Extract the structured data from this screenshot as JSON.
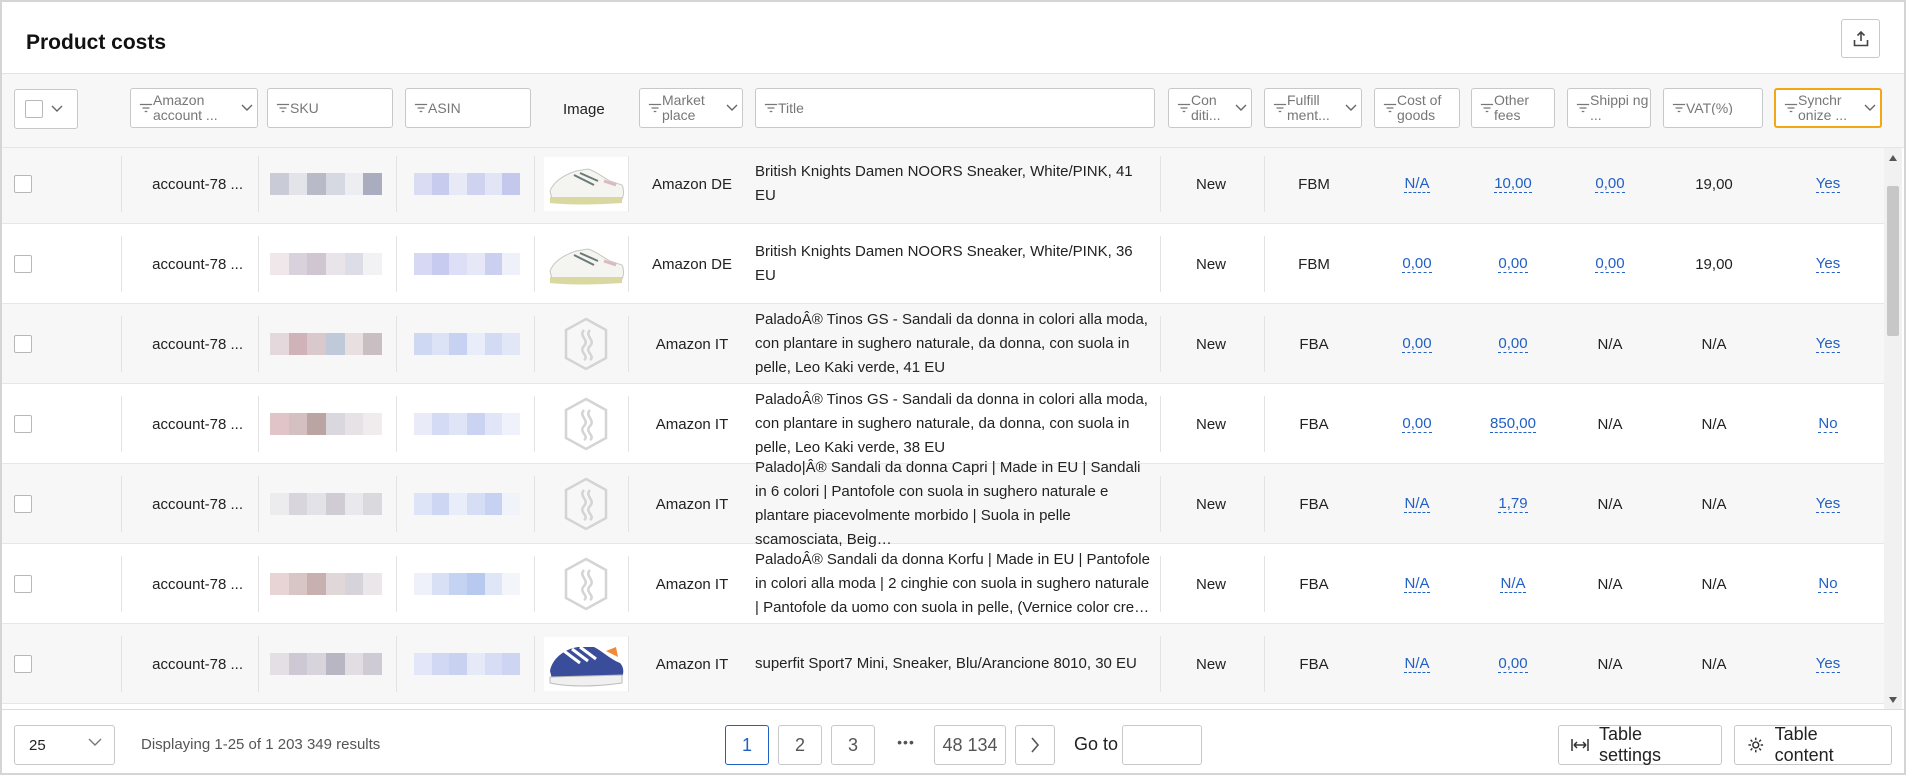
{
  "page": {
    "title": "Product costs"
  },
  "colors": {
    "accent": "#2160c4",
    "highlight": "#f3a712"
  },
  "filters": {
    "amazon_account": "Amazon account ...",
    "sku": "SKU",
    "asin": "ASIN",
    "image": "Image",
    "marketplace": "Market place",
    "title": "Title",
    "condition": "Con diti...",
    "fulfillment": "Fulfill ment...",
    "cost_of_goods": "Cost of goods",
    "other_fees": "Other fees",
    "shipping": "Shippi ng ...",
    "vat": "VAT(%)",
    "synchronize": "Synchr onize ..."
  },
  "rows": [
    {
      "account": "account-78 ...",
      "marketplace": "Amazon DE",
      "title": "British Knights Damen NOORS Sneaker, White/PINK, 41 EU",
      "condition": "New",
      "fulfillment": "FBM",
      "cost": "N/A",
      "other": "10,00",
      "shipping": "0,00",
      "vat": "19,00",
      "sync": "Yes",
      "image": "sneaker-white",
      "shipping_link": true,
      "vat_link": false
    },
    {
      "account": "account-78 ...",
      "marketplace": "Amazon DE",
      "title": "British Knights Damen NOORS Sneaker, White/PINK, 36 EU",
      "condition": "New",
      "fulfillment": "FBM",
      "cost": "0,00",
      "other": "0,00",
      "shipping": "0,00",
      "vat": "19,00",
      "sync": "Yes",
      "image": "sneaker-white",
      "shipping_link": true,
      "vat_link": false
    },
    {
      "account": "account-78 ...",
      "marketplace": "Amazon IT",
      "title": "PaladoÂ® Tinos GS - Sandali da donna in colori alla moda, con plantare in sughero naturale, da donna, con suola in pelle, Leo Kaki verde, 41 EU",
      "condition": "New",
      "fulfillment": "FBA",
      "cost": "0,00",
      "other": "0,00",
      "shipping": "N/A",
      "vat": "N/A",
      "sync": "Yes",
      "image": "placeholder",
      "shipping_link": false,
      "vat_link": false
    },
    {
      "account": "account-78 ...",
      "marketplace": "Amazon IT",
      "title": "PaladoÂ® Tinos GS - Sandali da donna in colori alla moda, con plantare in sughero naturale, da donna, con suola in pelle, Leo Kaki verde, 38 EU",
      "condition": "New",
      "fulfillment": "FBA",
      "cost": "0,00",
      "other": "850,00",
      "shipping": "N/A",
      "vat": "N/A",
      "sync": "No",
      "image": "placeholder",
      "shipping_link": false,
      "vat_link": false
    },
    {
      "account": "account-78 ...",
      "marketplace": "Amazon IT",
      "title": "Palado|Â® Sandali da donna Capri | Made in EU | Sandali in 6 colori | Pantofole con suola in sughero naturale e plantare piacevolmente morbido | Suola in pelle scamosciata, Beig…",
      "condition": "New",
      "fulfillment": "FBA",
      "cost": "N/A",
      "other": "1,79",
      "shipping": "N/A",
      "vat": "N/A",
      "sync": "Yes",
      "image": "placeholder",
      "shipping_link": false,
      "vat_link": false
    },
    {
      "account": "account-78 ...",
      "marketplace": "Amazon IT",
      "title": "PaladoÂ® Sandali da donna Korfu | Made in EU | Pantofole in colori alla moda | 2 cinghie con suola in sughero naturale | Pantofole da uomo con suola in pelle, (Vernice color cre…",
      "condition": "New",
      "fulfillment": "FBA",
      "cost": "N/A",
      "other": "N/A",
      "shipping": "N/A",
      "vat": "N/A",
      "sync": "No",
      "image": "placeholder",
      "shipping_link": false,
      "vat_link": false
    },
    {
      "account": "account-78 ...",
      "marketplace": "Amazon IT",
      "title": "superfit Sport7 Mini, Sneaker, Blu/Arancione 8010, 30 EU",
      "condition": "New",
      "fulfillment": "FBA",
      "cost": "N/A",
      "other": "0,00",
      "shipping": "N/A",
      "vat": "N/A",
      "sync": "Yes",
      "image": "sneaker-blue",
      "shipping_link": false,
      "vat_link": false
    }
  ],
  "footer": {
    "page_size": "25",
    "displaying": "Displaying 1-25 of 1 203 349 results",
    "pages": [
      "1",
      "2",
      "3"
    ],
    "ellipsis": "•••",
    "last_page": "48 134",
    "goto_label": "Go to",
    "table_settings": "Table settings",
    "table_content": "Table content"
  }
}
